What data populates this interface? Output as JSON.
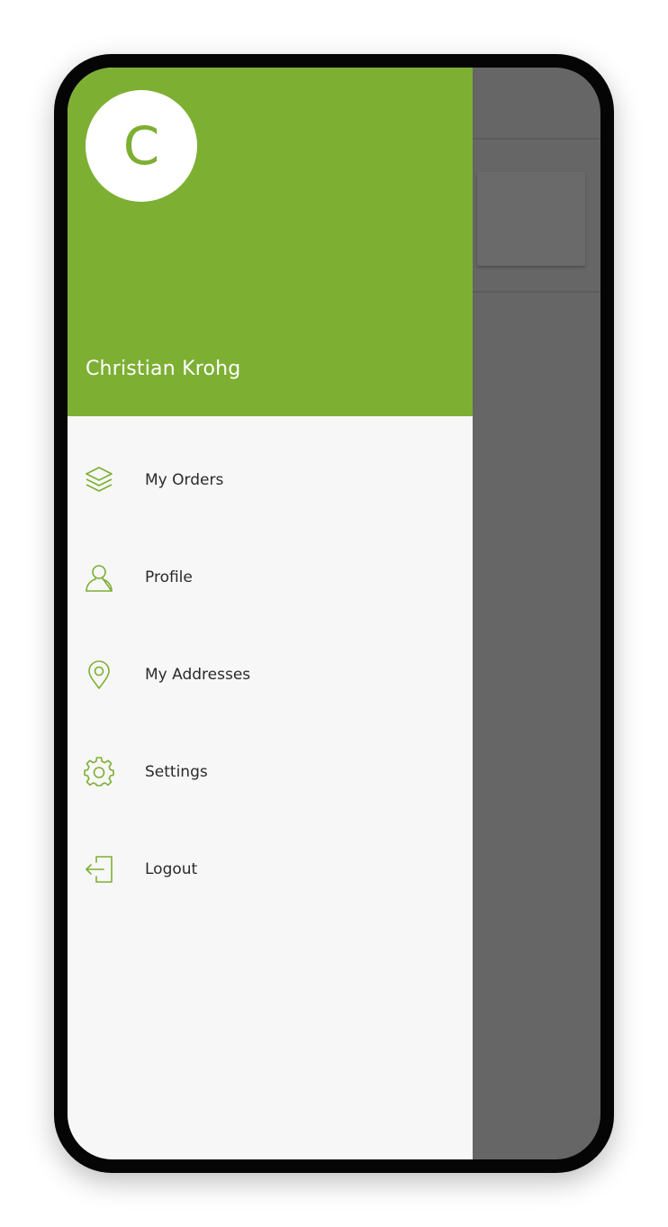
{
  "user": {
    "avatar_initial": "C",
    "name": "Christian Krohg"
  },
  "menu": {
    "items": [
      {
        "label": "My Orders",
        "icon": "layers-icon"
      },
      {
        "label": "Profile",
        "icon": "user-icon"
      },
      {
        "label": "My Addresses",
        "icon": "location-pin-icon"
      },
      {
        "label": "Settings",
        "icon": "gear-icon"
      },
      {
        "label": "Logout",
        "icon": "logout-icon"
      }
    ]
  },
  "colors": {
    "accent": "#7daf33",
    "drawer_background": "#f7f7f7",
    "scrim": "#666666",
    "frame": "#050505"
  }
}
